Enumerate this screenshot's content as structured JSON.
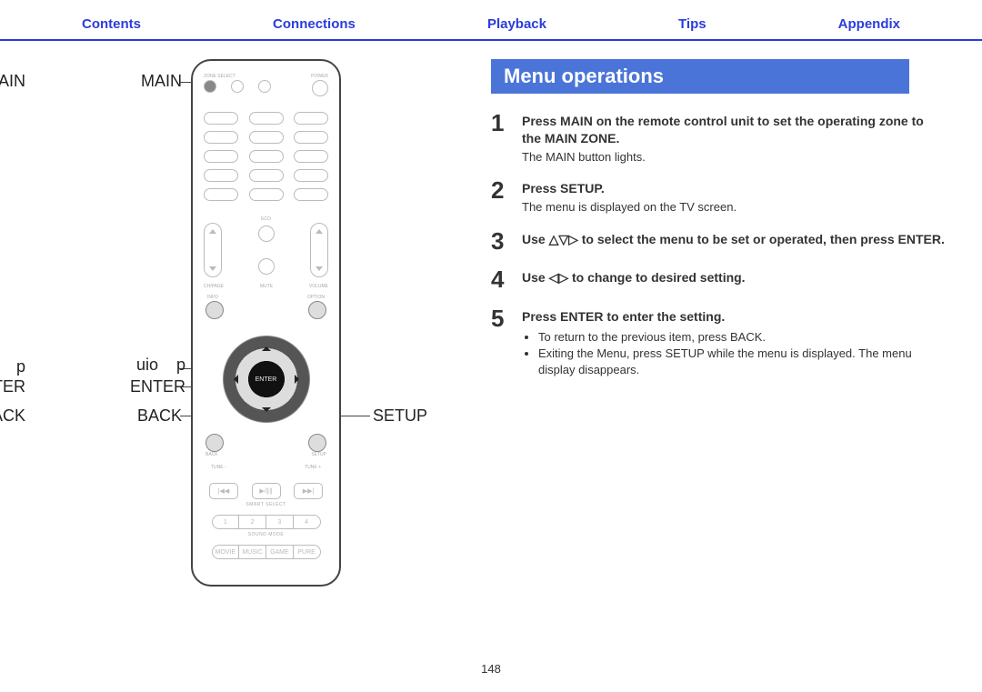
{
  "nav": {
    "contents": "Contents",
    "connections": "Connections",
    "playback": "Playback",
    "tips": "Tips",
    "appendix": "Appendix"
  },
  "section_title": "Menu operations",
  "steps": [
    {
      "num": "1",
      "bold": "Press MAIN on the remote control unit to set the operating zone to the MAIN ZONE.",
      "plain": "The MAIN button lights."
    },
    {
      "num": "2",
      "bold": "Press SETUP.",
      "plain": "The menu is displayed on the TV screen."
    },
    {
      "num": "3",
      "bold": "Use △▽▷ to select the menu to be set or operated, then press ENTER."
    },
    {
      "num": "4",
      "bold": "Use ◁▷ to change to desired setting."
    },
    {
      "num": "5",
      "bold": "Press ENTER to enter the setting.",
      "bullets": [
        "To return to the previous item, press BACK.",
        "Exiting the Menu, press SETUP while the menu is displayed. The menu display disappears."
      ]
    }
  ],
  "remote": {
    "callouts": {
      "main": "MAIN",
      "cursors": "uio    p",
      "enter": "ENTER",
      "back": "BACK",
      "setup": "SETUP"
    },
    "toprow_label_left": "ZONE SELECT",
    "toprow_label_right": "POWER",
    "dpad_center": "ENTER",
    "below_dpad_left": "BACK",
    "below_dpad_right": "SETUP",
    "info": "INFO",
    "option": "OPTION",
    "tune_minus": "TUNE -",
    "tune_plus": "TUNE +",
    "transport": [
      "|◀◀",
      "▶/∥∥",
      "▶▶|"
    ],
    "smart_select_label": "SMART SELECT",
    "smart_select": [
      "1",
      "2",
      "3",
      "4"
    ],
    "sound_mode_label": "SOUND MODE",
    "sound_mode": [
      "MOVIE",
      "MUSIC",
      "GAME",
      "PURE"
    ],
    "ch_page": "CH/PAGE",
    "mute": "MUTE",
    "volume": "VOLUME",
    "eco": "ECO"
  },
  "page_number": "148"
}
